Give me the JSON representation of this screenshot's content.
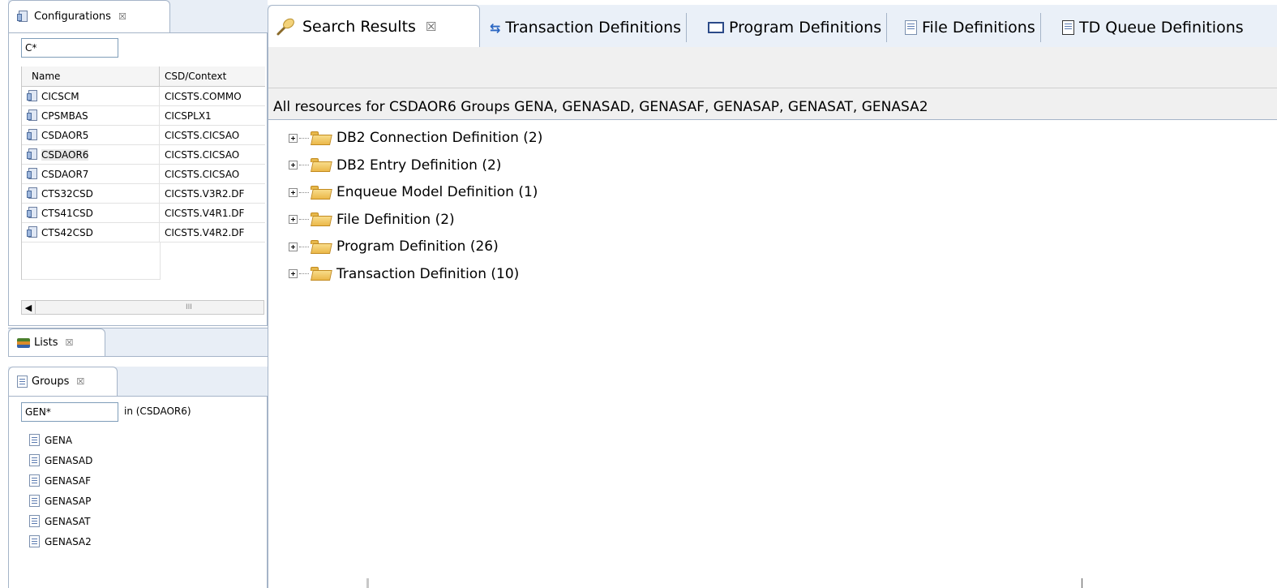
{
  "configurations": {
    "tab_label": "Configurations",
    "filter_value": "C*",
    "columns": [
      "Name",
      "CSD/Context"
    ],
    "rows": [
      {
        "name": "CICSCM",
        "context": "CICSTS.COMMO",
        "icon": "configuration-icon"
      },
      {
        "name": "CPSMBAS",
        "context": "CICSPLX1",
        "icon": "cpsm-icon"
      },
      {
        "name": "CSDAOR5",
        "context": "CICSTS.CICSAO",
        "icon": "configuration-icon"
      },
      {
        "name": "CSDAOR6",
        "context": "CICSTS.CICSAO",
        "icon": "configuration-icon"
      },
      {
        "name": "CSDAOR7",
        "context": "CICSTS.CICSAO",
        "icon": "configuration-icon"
      },
      {
        "name": "CTS32CSD",
        "context": "CICSTS.V3R2.DF",
        "icon": "configuration-icon"
      },
      {
        "name": "CTS41CSD",
        "context": "CICSTS.V4R1.DF",
        "icon": "configuration-icon"
      },
      {
        "name": "CTS42CSD",
        "context": "CICSTS.V4R2.DF",
        "icon": "configuration-icon"
      }
    ],
    "scroll_thumb": "III"
  },
  "lists": {
    "tab_label": "Lists"
  },
  "groups": {
    "tab_label": "Groups",
    "filter_value": "GEN*",
    "scope_label": "in (CSDAOR6)",
    "items": [
      "GENA",
      "GENASAD",
      "GENASAF",
      "GENASAP",
      "GENASAT",
      "GENASA2"
    ]
  },
  "editor": {
    "tabs": [
      {
        "label": "Search Results",
        "icon": "search-icon"
      },
      {
        "label": "Transaction Definitions",
        "icon": "transaction-icon"
      },
      {
        "label": "Program Definitions",
        "icon": "program-icon"
      },
      {
        "label": "File Definitions",
        "icon": "file-icon"
      },
      {
        "label": "TD Queue Definitions",
        "icon": "td-queue-icon"
      }
    ],
    "heading": "All resources for CSDAOR6 Groups GENA, GENASAD, GENASAF, GENASAP, GENASAT, GENASA2",
    "tree": [
      "DB2 Connection Definition (2)",
      "DB2 Entry Definition (2)",
      "Enqueue Model Definition (1)",
      "File Definition (2)",
      "Program Definition (26)",
      "Transaction Definition (10)"
    ]
  },
  "close_glyph": "☒"
}
